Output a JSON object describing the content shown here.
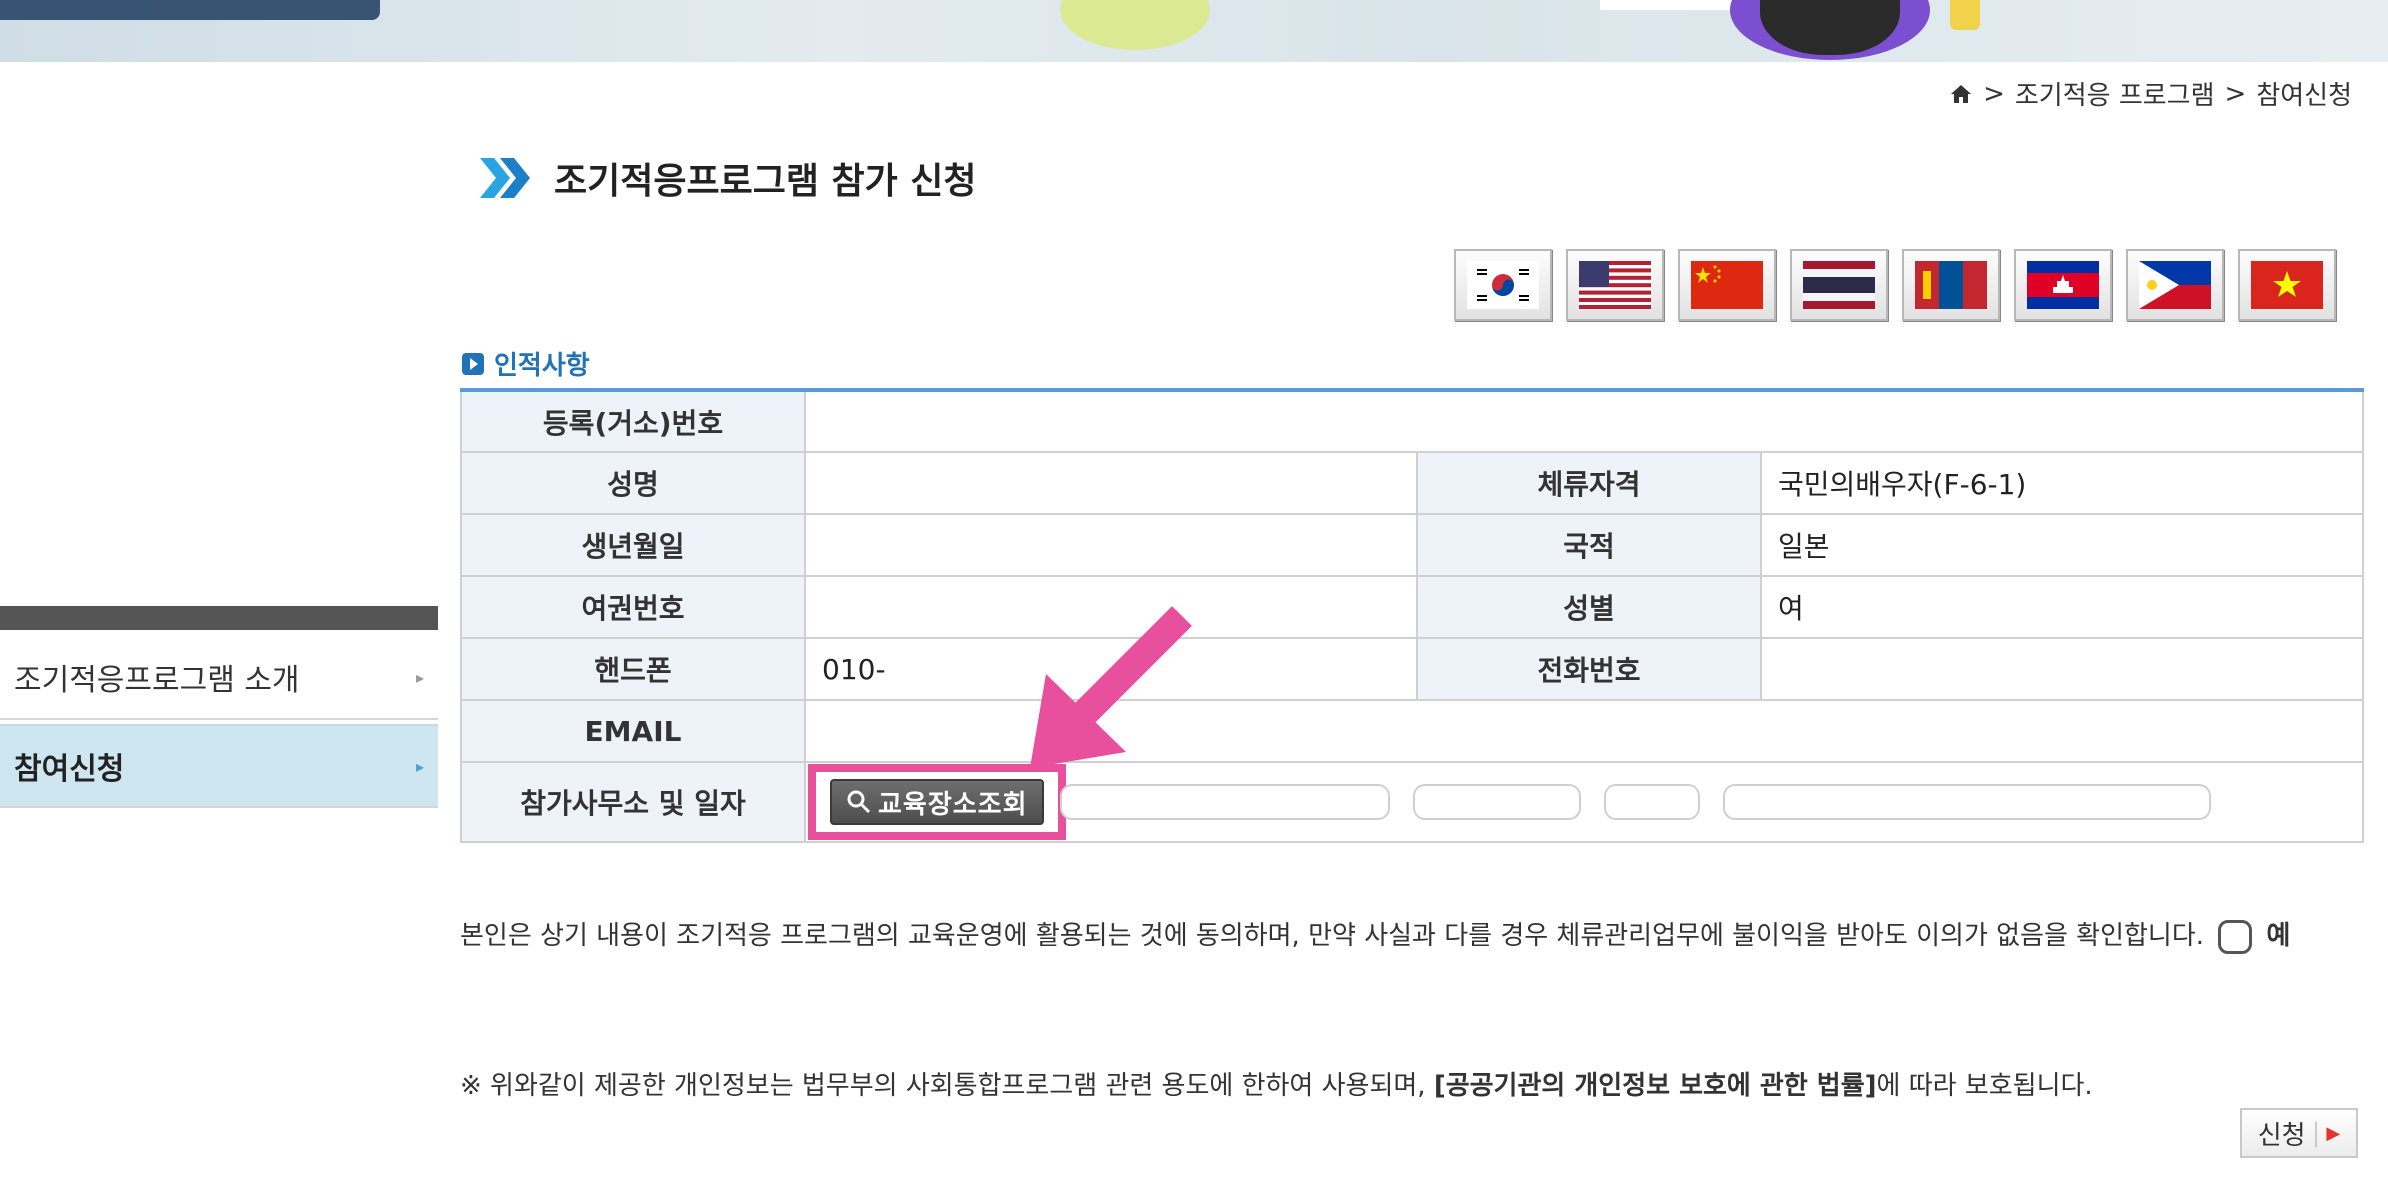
{
  "breadcrumb": {
    "sep1": ">",
    "item1": "조기적응 프로그램",
    "sep2": ">",
    "item2": "참여신청"
  },
  "page": {
    "title": "조기적응프로그램 참가 신청"
  },
  "flags": [
    "korea-flag-icon",
    "usa-flag-icon",
    "china-flag-icon",
    "thailand-flag-icon",
    "mongolia-flag-icon",
    "cambodia-flag-icon",
    "philippines-flag-icon",
    "vietnam-flag-icon"
  ],
  "section": {
    "label": "인적사항"
  },
  "table": {
    "reg_no_label": "등록(거소)번호",
    "reg_no_value": "",
    "name_label": "성명",
    "name_value": "",
    "visa_label": "체류자격",
    "visa_value": "국민의배우자(F-6-1)",
    "birth_label": "생년월일",
    "birth_value": "",
    "nationality_label": "국적",
    "nationality_value": "일본",
    "passport_label": "여권번호",
    "passport_value": "",
    "gender_label": "성별",
    "gender_value": "여",
    "mobile_label": "핸드폰",
    "mobile_value": "010-",
    "phone_label": "전화번호",
    "phone_value": "",
    "email_label": "EMAIL",
    "email_value": "",
    "office_label": "참가사무소 및 일자",
    "edu_button": "교육장소조회"
  },
  "sidebar": {
    "items": [
      {
        "label": "조기적응프로그램 소개",
        "arrow": "▸"
      },
      {
        "label": "참여신청",
        "arrow": "▸"
      }
    ]
  },
  "consent": {
    "text": "본인은 상기 내용이 조기적응 프로그램의 교육운영에 활용되는 것에 동의하며, 만약 사실과 다를 경우 체류관리업무에 불이익을 받아도 이의가 없음을 확인합니다.",
    "yes": "예"
  },
  "notice": {
    "prefix": "※ 위와같이 제공한 개인정보는 법무부의 사회통합프로그램 관련 용도에 한하여 사용되며, ",
    "law": "[공공기관의 개인정보 보호에 관한 법률]",
    "suffix": "에 따라 보호됩니다."
  },
  "submit": {
    "label": "신청",
    "sep": "|",
    "icon": "▶"
  },
  "colors": {
    "accent": "#2173b8",
    "highlight": "#e84f9c",
    "sidebar_active": "#cde6f0"
  }
}
